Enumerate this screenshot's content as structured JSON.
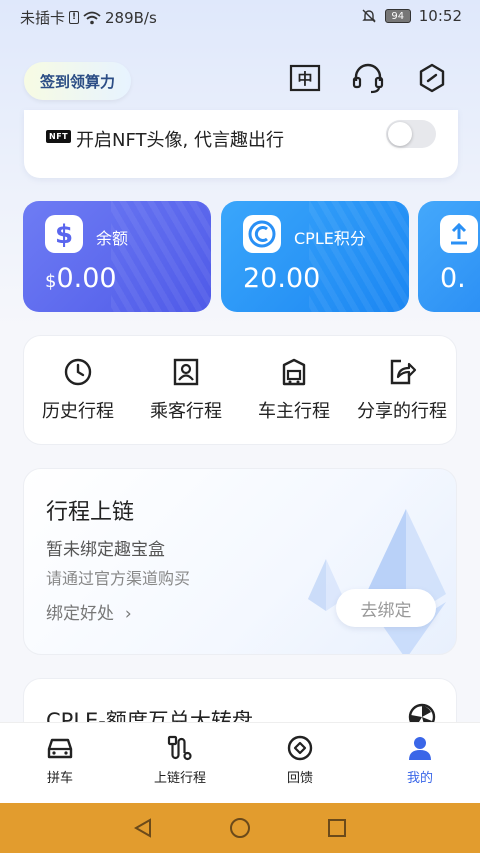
{
  "status_bar": {
    "carrier": "未插卡",
    "net_speed": "289B/s",
    "battery": "94",
    "time": "10:52"
  },
  "header": {
    "sign_button": "签到领算力",
    "icons": [
      "translate-icon",
      "headset-icon",
      "settings-hexagon-icon"
    ],
    "translate_glyph": "中"
  },
  "nft": {
    "badge": "NFT",
    "text": "开启NFT头像, 代言趣出行",
    "toggle_on": false
  },
  "balances": [
    {
      "label": "余额",
      "value_prefix": "$",
      "value": "0.00",
      "icon": "dollar-icon"
    },
    {
      "label": "CPLE积分",
      "value_prefix": "",
      "value": "20.00",
      "icon": "cple-coin-icon"
    },
    {
      "label": "",
      "value_prefix": "",
      "value": "0.",
      "icon": "upload-icon"
    }
  ],
  "trips": [
    {
      "label": "历史行程",
      "icon": "clock-icon"
    },
    {
      "label": "乘客行程",
      "icon": "passenger-icon"
    },
    {
      "label": "车主行程",
      "icon": "driver-car-icon"
    },
    {
      "label": "分享的行程",
      "icon": "share-icon"
    }
  ],
  "chain": {
    "title": "行程上链",
    "status": "暂未绑定趣宝盒",
    "hint": "请通过官方渠道购买",
    "benefit_link": "绑定好处",
    "benefit_chevron": "›",
    "bind_button": "去绑定"
  },
  "wheel": {
    "title": "CPLE-额度互兑大转盘"
  },
  "tabbar": {
    "tabs": [
      {
        "label": "拼车",
        "icon": "car-icon",
        "active": false
      },
      {
        "label": "上链行程",
        "icon": "route-icon",
        "active": false
      },
      {
        "label": "回馈",
        "icon": "feedback-icon",
        "active": false
      },
      {
        "label": "我的",
        "icon": "profile-icon",
        "active": true
      }
    ]
  },
  "colors": {
    "accent": "#3a66e8",
    "card_purple": "#5a66ee",
    "card_blue": "#2a90f5",
    "nav_bar": "#e29c2e"
  }
}
